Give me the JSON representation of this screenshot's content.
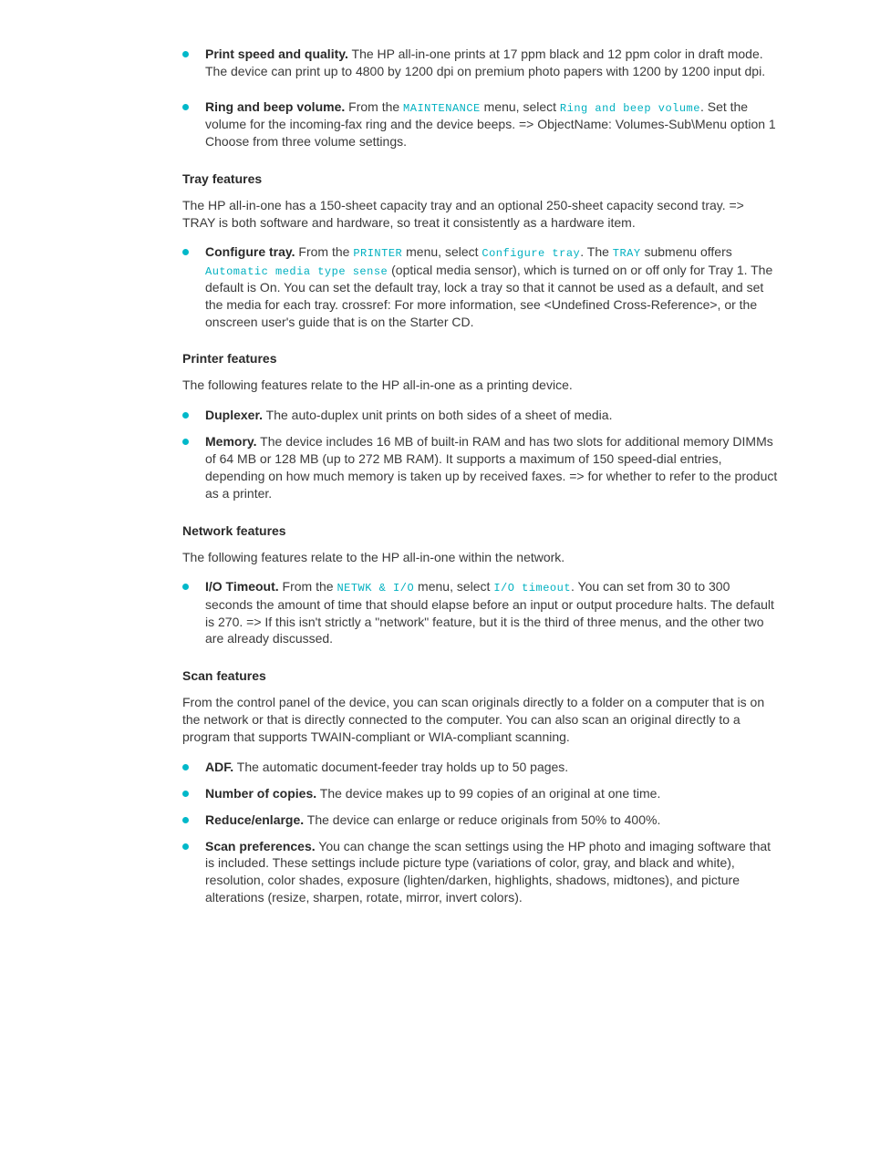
{
  "item1": {
    "heading": "Print speed and quality.",
    "text": " The HP all-in-one prints at 17 ppm black and 12 ppm color in draft mode. The device can print up to 4800 by 1200 dpi on premium photo papers with 1200 by 1200 input dpi."
  },
  "item2": {
    "heading": "Ring and beep volume.",
    "text_before": " From the ",
    "mono1": "MAINTENANCE",
    "text_mid": " menu, select ",
    "mono2": "Ring and beep volume",
    "text_after": ". Set the volume for the incoming-fax ring and the device beeps. => ObjectName: Volumes-Sub\\Menu option 1 Choose from three volume settings."
  },
  "section1": {
    "heading": "Tray features",
    "para": "The HP all-in-one has a 150-sheet capacity tray and an optional 250-sheet capacity second tray. => TRAY is both software and hardware, so treat it consistently as a hardware item."
  },
  "item3": {
    "heading": "Configure tray.",
    "text_before": " From the ",
    "mono1": "PRINTER",
    "text_mid1": " menu, select ",
    "mono2": "Configure tray",
    "text_mid2": ". The ",
    "mono3": "TRAY",
    "text_mid3": " submenu offers ",
    "mono4": "Automatic media type sense",
    "text_after": " (optical media sensor), which is turned on or off only for Tray 1. The default is On. You can set the default tray, lock a tray so that it cannot be used as a default, and set the media for each tray. crossref: For more information, see <Undefined Cross-Reference>, or the onscreen user's guide that is on the Starter CD."
  },
  "section2": {
    "heading": "Printer features",
    "para": "The following features relate to the HP all-in-one as a printing device."
  },
  "item4": {
    "heading": "Duplexer.",
    "text": " The auto-duplex unit prints on both sides of a sheet of media."
  },
  "item5": {
    "heading": "Memory.",
    "text": " The device includes 16 MB of built-in RAM and has two slots for additional memory DIMMs of 64 MB or 128 MB (up to 272 MB RAM). It supports a maximum of 150 speed-dial entries, depending on how much memory is taken up by received faxes. => for whether to refer to the product as a printer."
  },
  "section3": {
    "heading": "Network features",
    "para": "The following features relate to the HP all-in-one within the network."
  },
  "item6": {
    "heading": "I/O Timeout.",
    "text_before": " From the ",
    "mono1": "NETWK & I/O",
    "text_mid": " menu, select ",
    "mono2": "I/O timeout",
    "text_after": ". You can set from 30 to 300 seconds the amount of time that should elapse before an input or output procedure halts. The default is 270. => If this isn't strictly a \"network\" feature, but it is the third of three menus, and the other two are already discussed."
  },
  "section4": {
    "heading": "Scan features",
    "para": "From the control panel of the device, you can scan originals directly to a folder on a computer that is on the network or that is directly connected to the computer. You can also scan an original directly to a program that supports TWAIN-compliant or WIA-compliant scanning."
  },
  "item7": {
    "heading": "ADF.",
    "text": " The automatic document-feeder tray holds up to 50 pages."
  },
  "item8": {
    "heading": "Number of copies.",
    "text": " The device makes up to 99 copies of an original at one time."
  },
  "item9": {
    "heading": "Reduce/enlarge.",
    "text": " The device can enlarge or reduce originals from 50% to 400%."
  },
  "item10": {
    "heading": "Scan preferences.",
    "text": " You can change the scan settings using the HP photo and imaging software that is included. These settings include picture type (variations of color, gray, and black and white), resolution, color shades, exposure (lighten/darken, highlights, shadows, midtones), and picture alterations (resize, sharpen, rotate, mirror, invert colors)."
  }
}
